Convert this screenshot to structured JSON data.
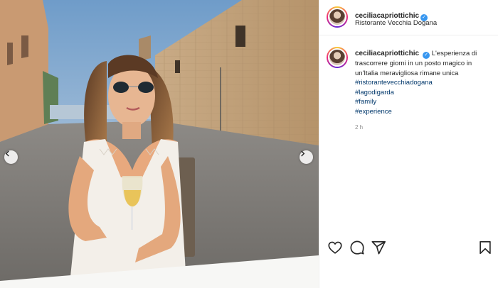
{
  "post": {
    "username": "ceciliacapriottichic",
    "verified": true,
    "location": "Ristorante Vecchia Dogana",
    "caption": "L'esperienza di trascorrere giorni in un posto magico in un'Italia meravigliosa rimane unica",
    "hashtags": [
      "#ristorantevecchiadogana",
      "#lagodigarda",
      "#family",
      "#experience"
    ],
    "time_ago": "2 h"
  },
  "icons": {
    "like": "heart-icon",
    "comment": "comment-icon",
    "share": "paper-plane-icon",
    "save": "bookmark-icon",
    "prev": "chevron-left-icon",
    "next": "chevron-right-icon",
    "verified": "verified-badge-icon"
  },
  "colors": {
    "verified": "#3897f0",
    "hashtag": "#00376b",
    "timestamp": "#8e8e8e"
  }
}
